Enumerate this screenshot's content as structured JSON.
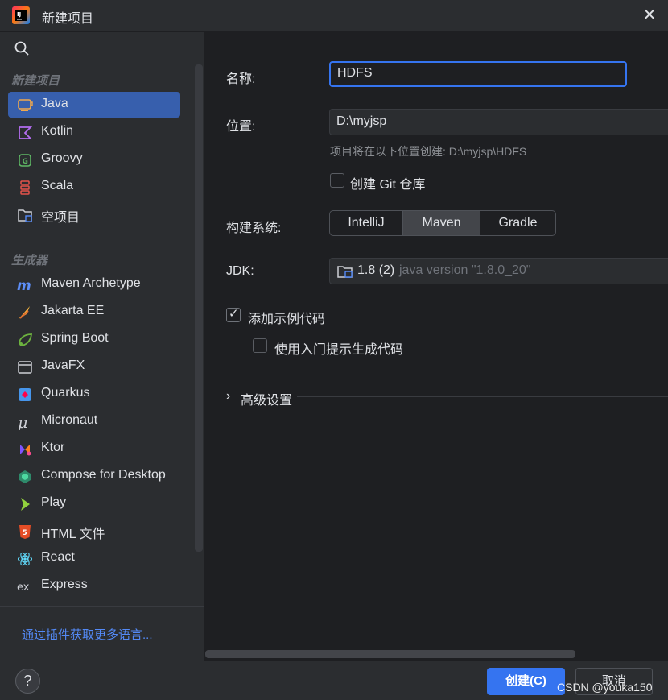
{
  "window": {
    "title": "新建项目",
    "close": "✕"
  },
  "sidebar": {
    "new_project_label": "新建项目",
    "generators_label": "生成器",
    "items": [
      {
        "label": "Java",
        "icon": "java-icon"
      },
      {
        "label": "Kotlin",
        "icon": "kotlin-icon"
      },
      {
        "label": "Groovy",
        "icon": "groovy-icon"
      },
      {
        "label": "Scala",
        "icon": "scala-icon"
      },
      {
        "label": "空项目",
        "icon": "empty-project-icon"
      }
    ],
    "generators": [
      {
        "label": "Maven Archetype",
        "icon": "maven-icon"
      },
      {
        "label": "Jakarta EE",
        "icon": "jakarta-ee-icon"
      },
      {
        "label": "Spring Boot",
        "icon": "spring-boot-icon"
      },
      {
        "label": "JavaFX",
        "icon": "javafx-icon"
      },
      {
        "label": "Quarkus",
        "icon": "quarkus-icon"
      },
      {
        "label": "Micronaut",
        "icon": "micronaut-icon"
      },
      {
        "label": "Ktor",
        "icon": "ktor-icon"
      },
      {
        "label": "Compose for Desktop",
        "icon": "compose-icon"
      },
      {
        "label": "Play",
        "icon": "play-icon"
      },
      {
        "label": "HTML 文件",
        "icon": "html5-icon"
      },
      {
        "label": "React",
        "icon": "react-icon"
      },
      {
        "label": "Express",
        "icon": "express-icon"
      }
    ],
    "plugin_link": "通过插件获取更多语言..."
  },
  "form": {
    "name_label": "名称:",
    "name_value": "HDFS",
    "location_label": "位置:",
    "location_value": "D:\\myjsp",
    "location_hint": "项目将在以下位置创建: D:\\myjsp\\HDFS",
    "git_label": "创建 Git 仓库",
    "build_label": "构建系统:",
    "build_options": [
      "IntelliJ",
      "Maven",
      "Gradle"
    ],
    "build_selected": "Maven",
    "jdk_label": "JDK:",
    "jdk_version": "1.8 (2)",
    "jdk_desc": "java version \"1.8.0_20\"",
    "sample_code_label": "添加示例代码",
    "onboarding_label": "使用入门提示生成代码",
    "advanced_label": "高级设置"
  },
  "footer": {
    "help": "?",
    "create": "创建(C)",
    "cancel": "取消",
    "watermark": "CSDN @youka150"
  },
  "colors": {
    "accent": "#3574f0",
    "selection": "#375fad",
    "link": "#548af7"
  }
}
